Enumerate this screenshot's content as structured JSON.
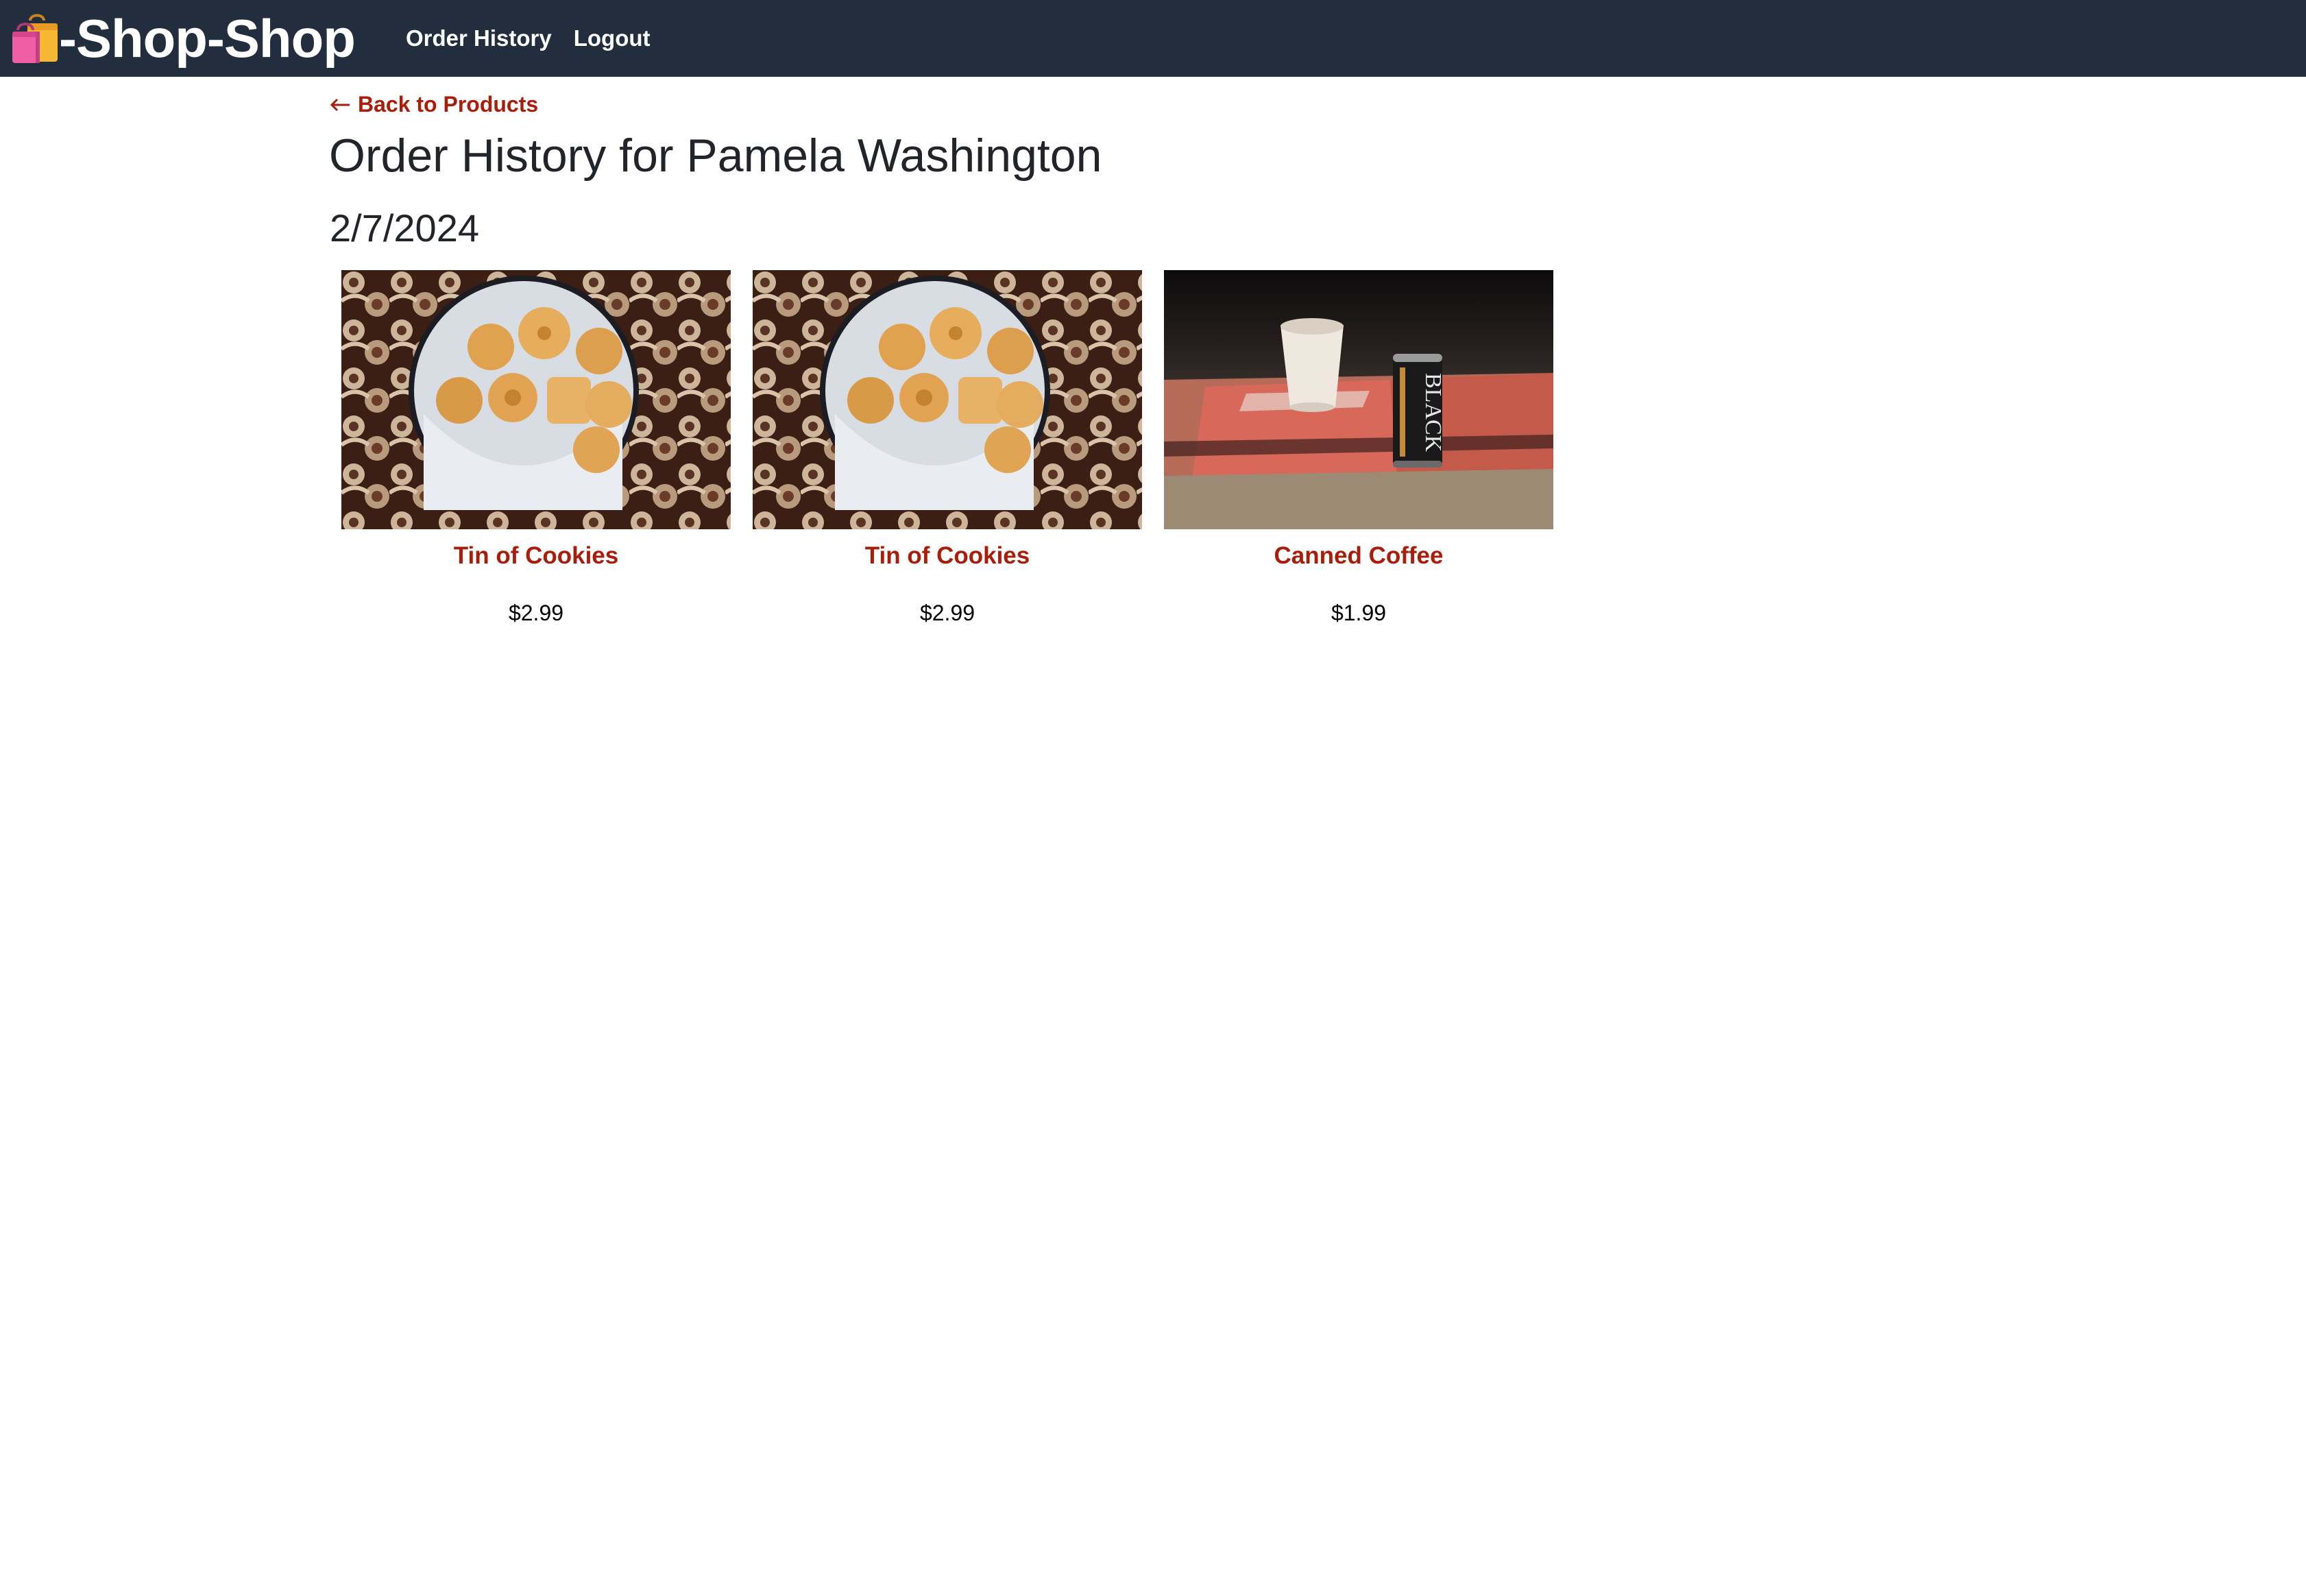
{
  "header": {
    "brand": "-Shop-Shop",
    "brand_icon": "shopping-bags-icon",
    "nav": [
      "Order History",
      "Logout"
    ]
  },
  "main": {
    "back_link": "Back to Products",
    "back_icon": "left-arrow-icon",
    "title": "Order History for Pamela Washington",
    "order_date": "2/7/2024",
    "products": [
      {
        "name": "Tin of Cookies",
        "price": "$2.99",
        "image": "tin-of-cookies-image"
      },
      {
        "name": "Tin of Cookies",
        "price": "$2.99",
        "image": "tin-of-cookies-image"
      },
      {
        "name": "Canned Coffee",
        "price": "$1.99",
        "image": "canned-coffee-image"
      }
    ]
  },
  "colors": {
    "header_bg": "#222e3d",
    "link": "#a91e0a",
    "text": "#212529"
  }
}
